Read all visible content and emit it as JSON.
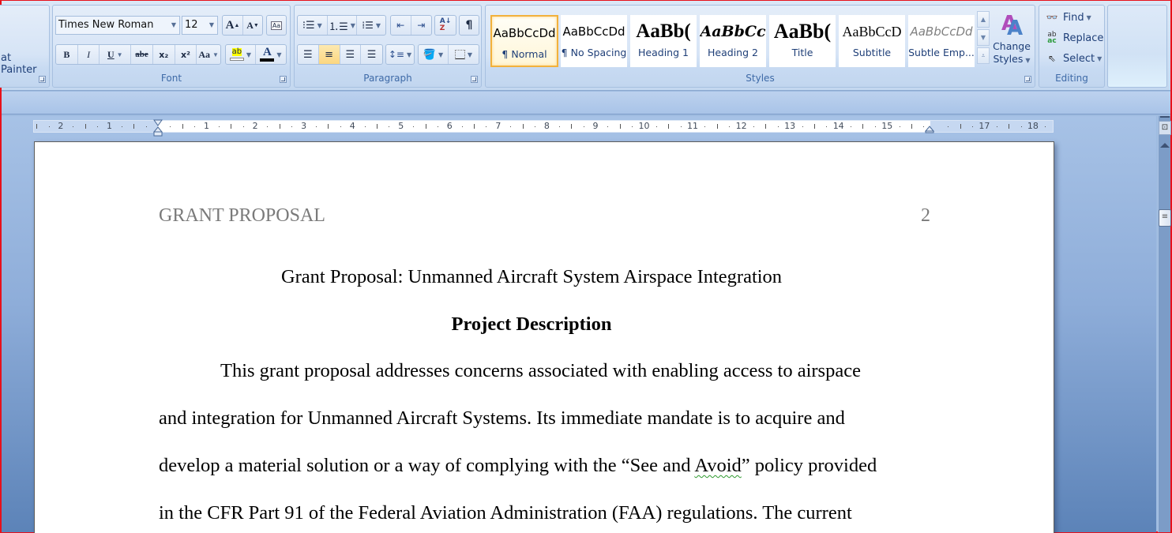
{
  "ribbon": {
    "clipboard": {
      "format_painter_label": "at Painter"
    },
    "font": {
      "group_label": "Font",
      "font_name": "Times New Roman",
      "font_size": "12",
      "grow_font_glyph": "A",
      "shrink_font_glyph": "A",
      "bold_glyph": "B",
      "italic_glyph": "I",
      "underline_glyph": "U",
      "strikethrough_glyph": "abe",
      "subscript_glyph": "x₂",
      "superscript_glyph": "x²",
      "change_case_glyph": "Aa",
      "highlight_glyph": "ab",
      "font_color_glyph": "A",
      "font_color": "#000000",
      "highlight_color": "#ffff00"
    },
    "paragraph": {
      "group_label": "Paragraph",
      "active_alignment": "center",
      "show_hide_glyph": "¶"
    },
    "styles": {
      "group_label": "Styles",
      "tiles": [
        {
          "sample": "AaBbCcDd",
          "name": "¶ Normal",
          "selected": true
        },
        {
          "sample": "AaBbCcDd",
          "name": "¶ No Spacing",
          "selected": false
        },
        {
          "sample": "AaBb(",
          "name": "Heading 1",
          "selected": false
        },
        {
          "sample": "AaBbCc",
          "name": "Heading 2",
          "selected": false
        },
        {
          "sample": "AaBb(",
          "name": "Title",
          "selected": false
        },
        {
          "sample": "AaBbCcD",
          "name": "Subtitle",
          "selected": false
        },
        {
          "sample": "AaBbCcDd",
          "name": "Subtle Emp...",
          "selected": false
        }
      ],
      "change_styles_label_1": "Change",
      "change_styles_label_2": "Styles"
    },
    "editing": {
      "group_label": "Editing",
      "find_label": "Find",
      "replace_label": "Replace",
      "select_label": "Select"
    }
  },
  "ruler": {
    "left_numbers": [
      "2",
      "1"
    ],
    "right_numbers": [
      "1",
      "2",
      "3",
      "4",
      "5",
      "6",
      "7",
      "8",
      "9",
      "10",
      "11",
      "12",
      "13",
      "14",
      "15",
      "16",
      "17",
      "18"
    ],
    "unit": "cm"
  },
  "document": {
    "header_text": "GRANT PROPOSAL",
    "page_number": "2",
    "title": "Grant Proposal: Unmanned Aircraft System Airspace Integration",
    "heading": "Project Description",
    "lines": [
      "This grant proposal addresses concerns associated with enabling access to airspace",
      "and integration for Unmanned Aircraft Systems. Its immediate mandate is to acquire and",
      "develop a material solution or a way of complying with the “See and ",
      "in the CFR Part 91 of the Federal Aviation Administration (FAA) regulations. The current"
    ],
    "squiggle_word": "Avoid",
    "line3_tail": "” policy provided"
  }
}
